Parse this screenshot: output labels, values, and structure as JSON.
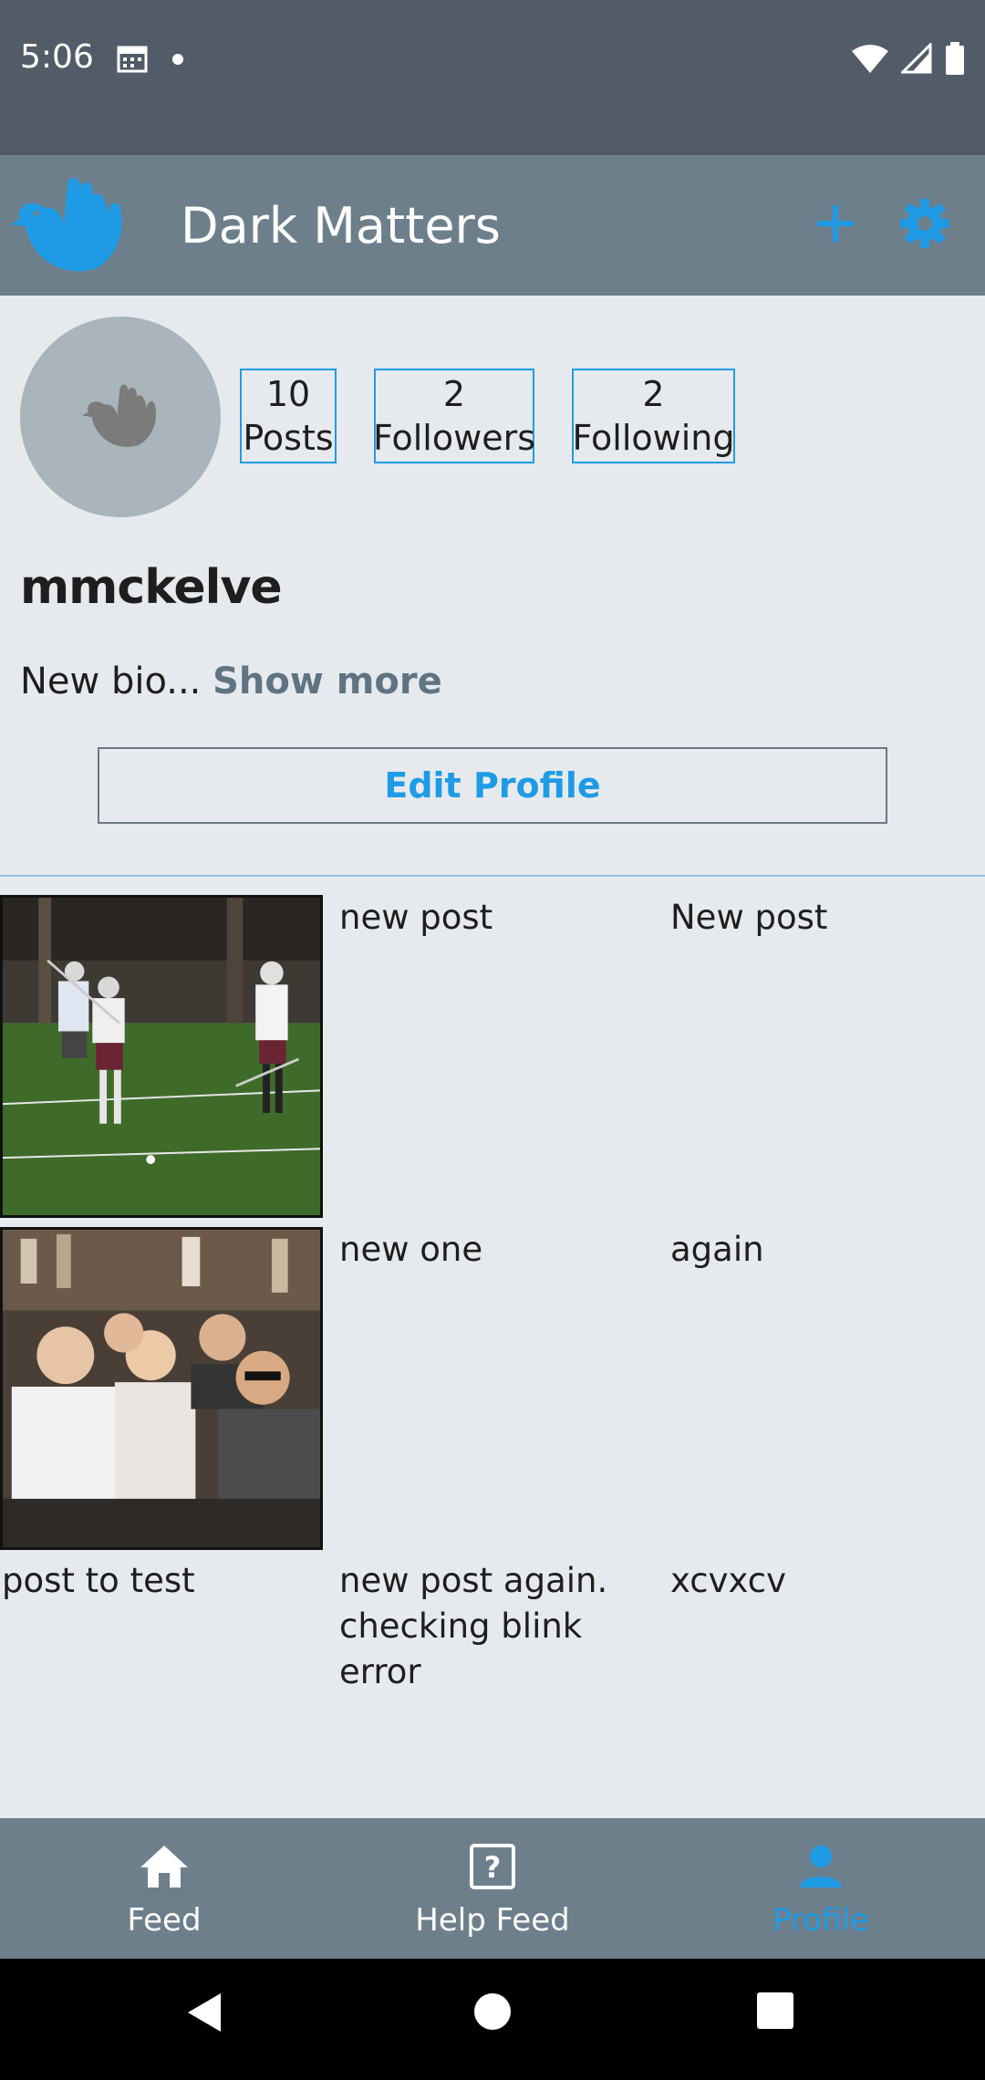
{
  "status_bar": {
    "time": "5:06",
    "left_icons": [
      "calendar-icon",
      "dot-icon"
    ],
    "right_icons": [
      "wifi-icon",
      "signal-icon",
      "battery-icon"
    ]
  },
  "app_bar": {
    "title": "Dark Matters",
    "logo": "dove-hand-logo",
    "actions": [
      "plus-icon",
      "gear-icon"
    ],
    "accent_color": "#1f9be6",
    "background_color": "#6e7f8c"
  },
  "profile": {
    "avatar_icon": "dove-hand-icon",
    "stats": [
      {
        "value": "10",
        "label": "Posts"
      },
      {
        "value": "2",
        "label": "Followers"
      },
      {
        "value": "2",
        "label": "Following"
      }
    ],
    "username": "mmckelve",
    "bio": "New bio...",
    "show_more": "Show more",
    "edit_button": "Edit Profile"
  },
  "posts": [
    {
      "type": "image",
      "description_icon": "lacrosse-photo"
    },
    {
      "type": "text",
      "text": "new post"
    },
    {
      "type": "text",
      "text": "New post"
    },
    {
      "type": "image",
      "description_icon": "group-photo"
    },
    {
      "type": "text",
      "text": "new one"
    },
    {
      "type": "text",
      "text": "again"
    },
    {
      "type": "text",
      "text": "post to test"
    },
    {
      "type": "text",
      "text": "new post again. checking blink error"
    },
    {
      "type": "text",
      "text": "xcvxcv"
    }
  ],
  "bottom_nav": {
    "items": [
      {
        "label": "Feed",
        "icon": "home-icon",
        "active": false
      },
      {
        "label": "Help Feed",
        "icon": "question-icon",
        "active": false
      },
      {
        "label": "Profile",
        "icon": "person-icon",
        "active": true
      }
    ]
  },
  "system_nav": [
    "back-icon",
    "home-circle-icon",
    "recents-icon"
  ]
}
